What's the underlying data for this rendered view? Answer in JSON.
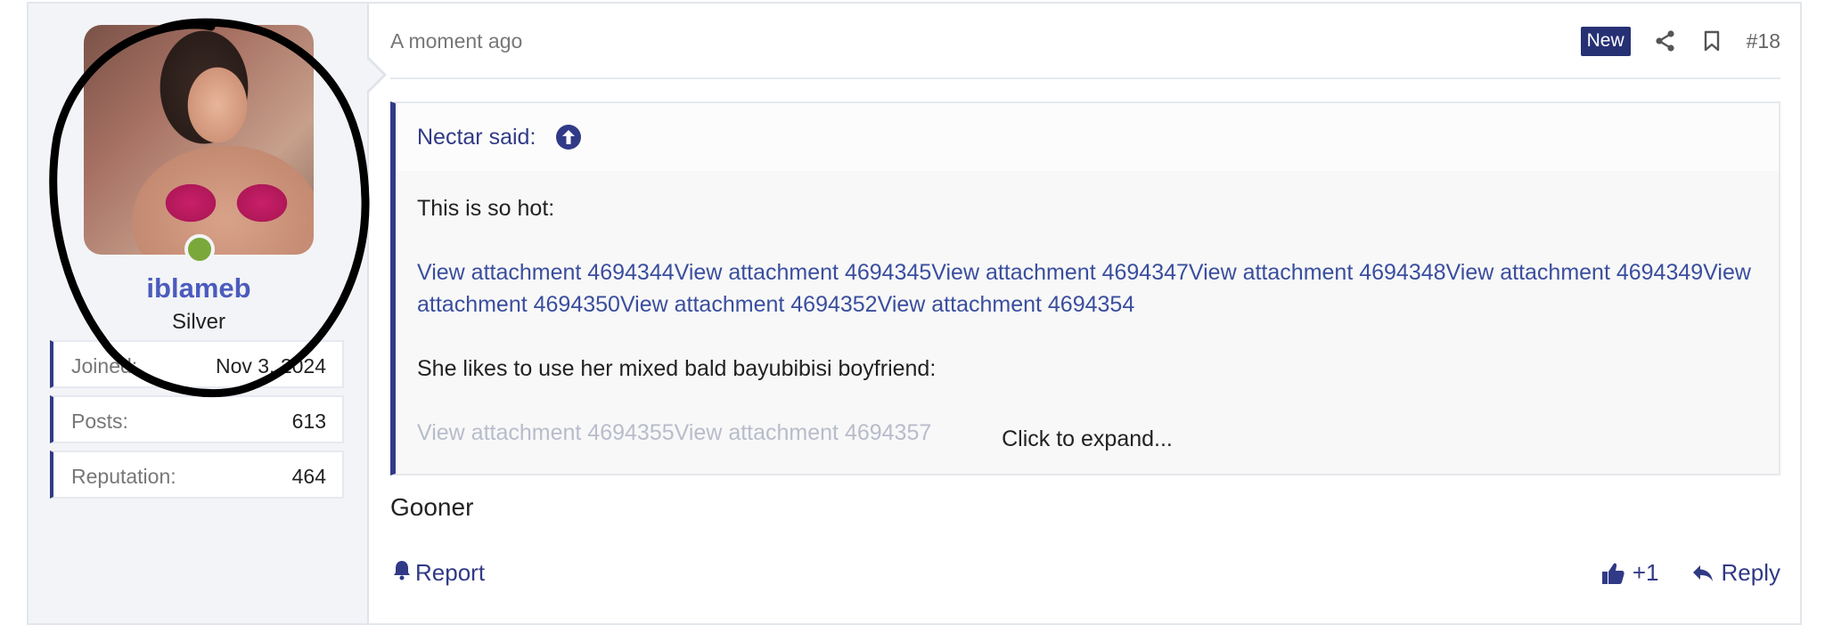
{
  "user": {
    "username": "iblameb",
    "title": "Silver",
    "online": true,
    "stats": [
      {
        "label": "Joined:",
        "value": "Nov 3, 2024"
      },
      {
        "label": "Posts:",
        "value": "613"
      },
      {
        "label": "Reputation:",
        "value": "464"
      }
    ]
  },
  "post": {
    "time": "A moment ago",
    "badge": "New",
    "number": "#18",
    "quote": {
      "author": "Nectar said:",
      "line1": "This is so hot:",
      "links1": "View attachment 4694344View attachment 4694345View attachment 4694347View attachment 4694348View attachment 4694349View attachment 4694350View attachment 4694352View attachment 4694354",
      "line2": "She likes to use her mixed bald bayubibisi boyfriend:",
      "links2": "View attachment 4694355View attachment 4694357",
      "expand": "Click to expand..."
    },
    "body": "Gooner",
    "actions": {
      "report": "Report",
      "like_count": "+1",
      "reply": "Reply"
    }
  },
  "colors": {
    "accent": "#313a86",
    "username": "#4b5bbd",
    "online": "#7aa83a",
    "badge_bg": "#263174"
  }
}
